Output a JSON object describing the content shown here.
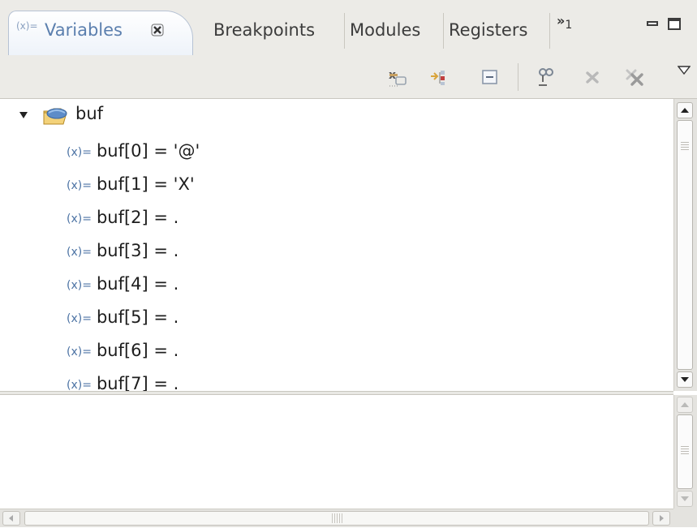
{
  "tabs": {
    "active": {
      "icon": "(x)=",
      "label": "Variables"
    },
    "others": [
      "Breakpoints",
      "Modules",
      "Registers"
    ],
    "overflow_chevron": "»",
    "overflow_count": "1"
  },
  "toolbar": {
    "buttons": [
      "show-type-names-icon",
      "show-logical-structure-icon",
      "collapse-all-icon",
      "connect-icon",
      "remove-icon",
      "remove-all-icon"
    ],
    "view_menu_icon": "view-menu-triangle-icon"
  },
  "tree": {
    "root": {
      "name": "buf",
      "expanded": true
    },
    "var_icon": "(x)=",
    "children": [
      "buf[0] = '@'",
      "buf[1] = 'X'",
      "buf[2] = .",
      "buf[3] = .",
      "buf[4] = .",
      "buf[5] = .",
      "buf[6] = .",
      "buf[7] = ."
    ]
  },
  "colors": {
    "active_tab_text": "#5b7fae",
    "variable_icon": "#4c73a4",
    "chrome_background": "#ecebe7"
  }
}
